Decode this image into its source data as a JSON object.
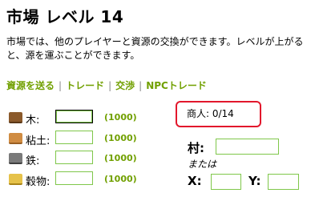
{
  "page": {
    "title": "市場 レベル 14",
    "description": "市場では、他のプレイヤーと資源の交換ができます。レベルが上がると、源を運ぶことができます。"
  },
  "nav": {
    "send_resources": "資源を送る",
    "trade": "トレード",
    "negotiate": "交渉",
    "npc_trade": "NPCトレード"
  },
  "resources": [
    {
      "icon": "wood-icon",
      "label": "木:",
      "value": "",
      "max": "(1000)",
      "color": "#8b5a2b"
    },
    {
      "icon": "clay-icon",
      "label": "粘土:",
      "value": "",
      "max": "(1000)",
      "color": "#c9863d"
    },
    {
      "icon": "iron-icon",
      "label": "鉄:",
      "value": "",
      "max": "(1000)",
      "color": "#6b6b6b"
    },
    {
      "icon": "crop-icon",
      "label": "穀物:",
      "value": "",
      "max": "(1000)",
      "color": "#e2b93b"
    }
  ],
  "merchants": {
    "label": "商人: 0/14"
  },
  "target": {
    "village_label": "村:",
    "or_label": "または",
    "x_label": "X:",
    "y_label": "Y:"
  }
}
